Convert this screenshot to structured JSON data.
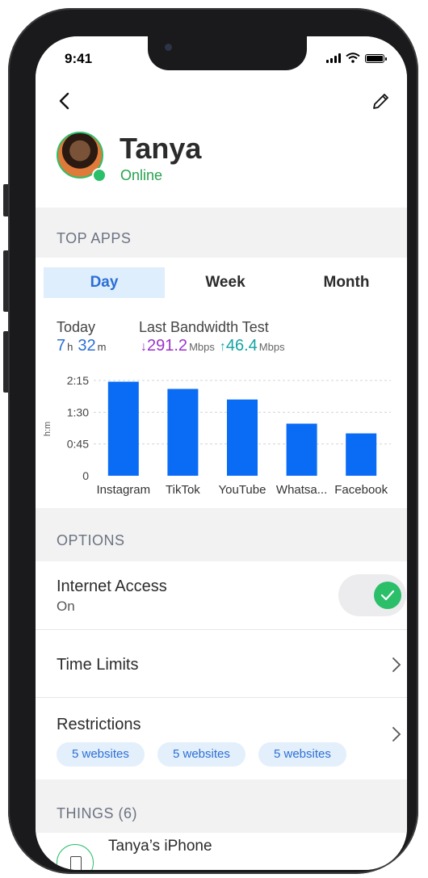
{
  "status_bar": {
    "time": "9:41"
  },
  "profile": {
    "name": "Tanya",
    "status": "Online"
  },
  "top_apps": {
    "section_title": "TOP APPS",
    "tabs": [
      {
        "label": "Day",
        "active": true
      },
      {
        "label": "Week",
        "active": false
      },
      {
        "label": "Month",
        "active": false
      }
    ],
    "today_label": "Today",
    "today_hours": "7",
    "today_hours_unit": "h",
    "today_minutes": "32",
    "today_minutes_unit": "m",
    "bandwidth_label": "Last Bandwidth Test",
    "download_value": "291.2",
    "upload_value": "46.4",
    "speed_unit": "Mbps"
  },
  "chart_data": {
    "type": "bar",
    "categories": [
      "Instagram",
      "TikTok",
      "YouTube",
      "Whatsa...",
      "Facebook"
    ],
    "values": [
      2.22,
      2.05,
      1.8,
      1.23,
      1.0
    ],
    "yticks": [
      "0",
      "0:45",
      "1:30",
      "2:15"
    ],
    "ylabel": "h:m",
    "ylim": [
      0,
      2.25
    ],
    "bar_color": "#0a6cf4",
    "grid": true
  },
  "options": {
    "section_title": "OPTIONS",
    "internet_access": {
      "title": "Internet Access",
      "value": "On",
      "enabled": true
    },
    "time_limits": {
      "title": "Time Limits"
    },
    "restrictions": {
      "title": "Restrictions",
      "tags": [
        "5 websites",
        "5 websites",
        "5 websites"
      ]
    }
  },
  "things": {
    "section_title": "THINGS (6)",
    "items": [
      {
        "name": "Tanya’s iPhone"
      }
    ]
  },
  "colors": {
    "accent": "#2b6fd6",
    "online": "#27a34e",
    "download": "#9b33cc",
    "upload": "#14a3a3"
  }
}
